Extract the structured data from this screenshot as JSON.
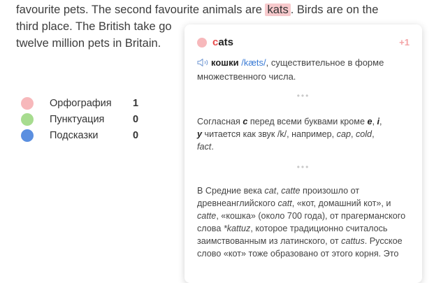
{
  "essay": {
    "line1_pre": "favourite pets. The second favourite animals are ",
    "line1_word": "kats",
    "line1_post": ". Birds are on the",
    "line2": "third place. The British take go",
    "line3": "twelve million pets in Britain."
  },
  "stats": [
    {
      "label": "Орфография",
      "count": "1",
      "color": "#f7b8bb"
    },
    {
      "label": "Пунктуация",
      "count": "0",
      "color": "#a7dc8f"
    },
    {
      "label": "Подсказки",
      "count": "0",
      "color": "#5b8fe0"
    }
  ],
  "popup": {
    "word_first": "c",
    "word_rest": "ats",
    "plus": "+1",
    "translation_word": "кошки",
    "ipa": "/kæts/",
    "translation_rest": ", существительное в форме множественного числа.",
    "separator": "•••",
    "rule": {
      "t1": "Согласная ",
      "c": "c",
      "t2": " перед всеми буквами кроме ",
      "e": "e",
      "comma1": ", ",
      "i": "i",
      "comma2": ",",
      "y": "y",
      "t3": " читается как звук /k/, например, ",
      "ex1": "cap",
      "comma3": ", ",
      "ex2": "cold",
      "comma4": ",",
      "ex3": "fact",
      "dot": "."
    },
    "etym": {
      "t1": "В Средние века ",
      "cat": "cat",
      "comma": ", ",
      "catte": "catte",
      "t2": " произошло от древнеанглийского ",
      "catt": "catt",
      "t3": ", «кот, домашний кот», и ",
      "catte2": "catte",
      "t4": ", «кошка» (около 700 года), от прагерманского слова ",
      "kattuz": "*kattuz",
      "t5": ", которое традиционно считалось заимствованным из латинского, от ",
      "cattus": "cattus",
      "t6": ". Русское слово «кот» тоже образовано от этого корня. Это"
    }
  }
}
